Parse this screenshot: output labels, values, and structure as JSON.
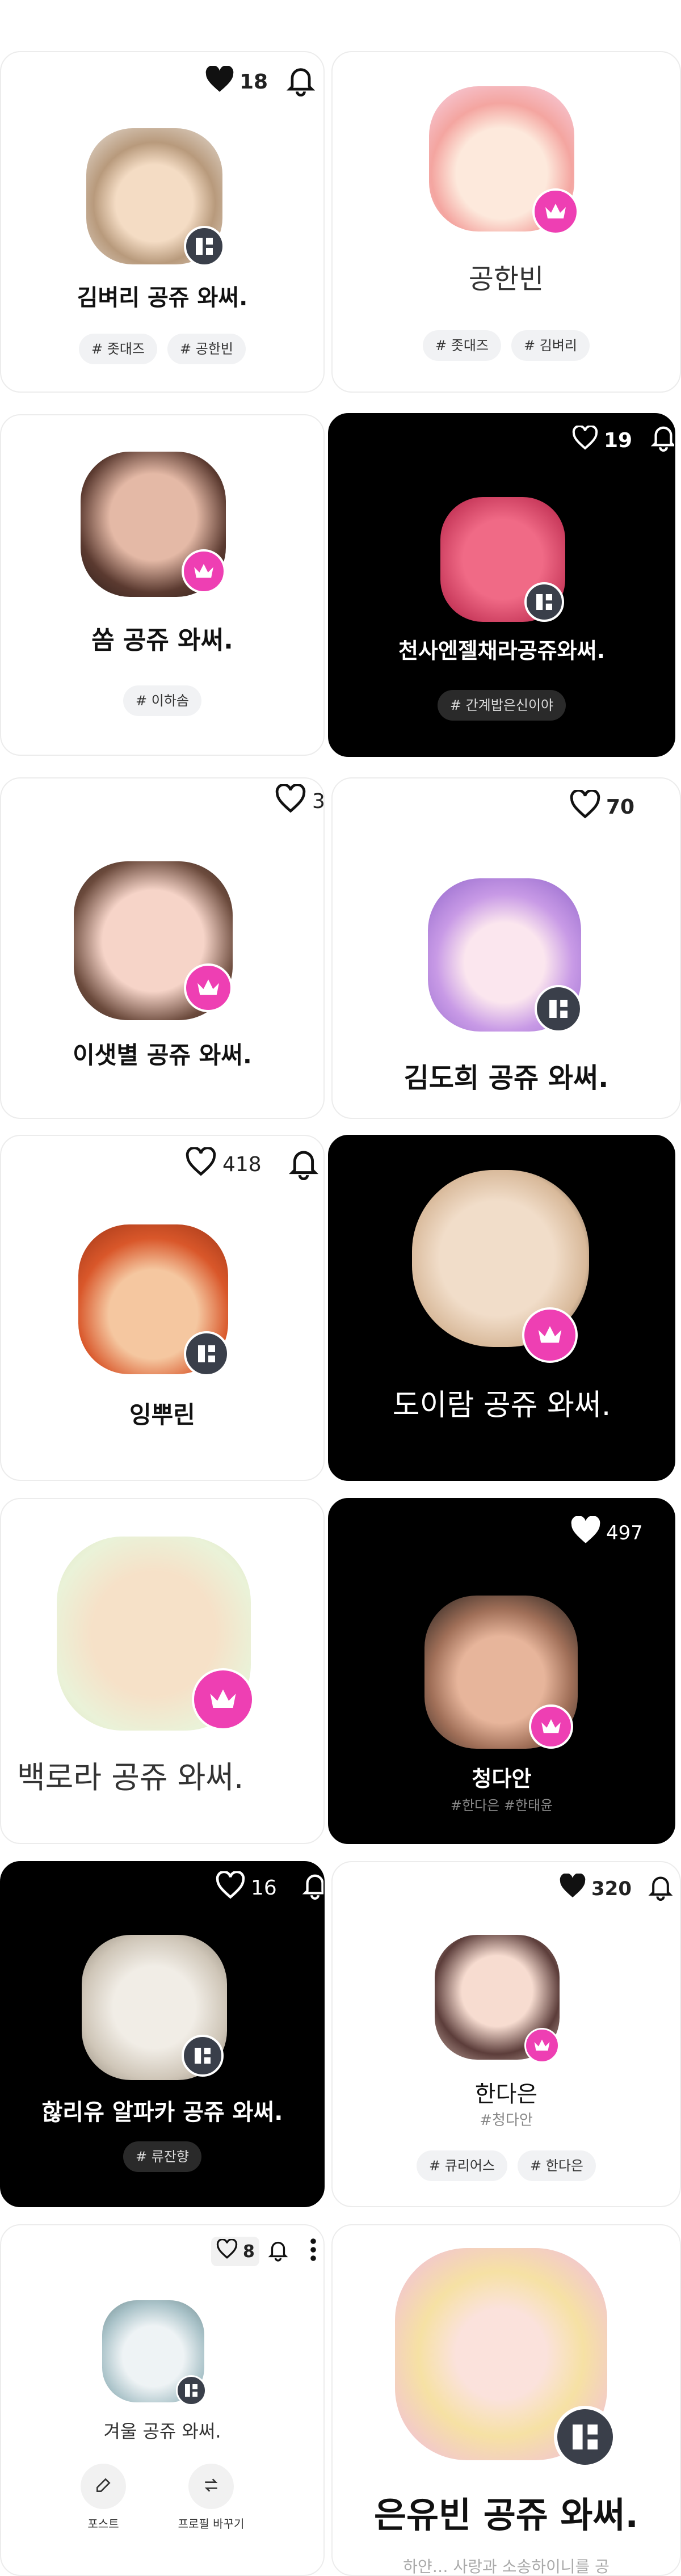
{
  "cards": [
    {
      "name": "김벼리 공쥬 와써.",
      "likes": "18",
      "tags": [
        "# 좃대즈",
        "# 공한빈"
      ]
    },
    {
      "name": "공한빈",
      "tags": [
        "# 좃대즈",
        "# 김벼리"
      ]
    },
    {
      "name": "쏨 공쥬 와써.",
      "tags": [
        "# 이하솜"
      ]
    },
    {
      "name": "천사엔젤채라공쥬와써.",
      "likes": "19",
      "tags": [
        "# 간계밥은신이야"
      ]
    },
    {
      "name": "이샛별 공쥬 와써.",
      "likes": "3"
    },
    {
      "name": "김도희 공쥬 와써.",
      "likes": "70"
    },
    {
      "name": "잉뿌린",
      "likes": "418"
    },
    {
      "name": "도이람 공쥬 와써."
    },
    {
      "name": "백로라 공쥬 와써."
    },
    {
      "name": "청다안",
      "likes": "497",
      "sub": "#한다은 #한태윤"
    },
    {
      "name": "핞리유 알파카 공쥬 와써.",
      "likes": "16",
      "tags": [
        "# 류잔향"
      ]
    },
    {
      "name": "한다은",
      "likes": "320",
      "sub": "#청다안",
      "tags": [
        "# 큐리어스",
        "# 한다은"
      ]
    },
    {
      "name": "겨울 공쥬 와써.",
      "likes": "8",
      "actions": [
        "포스트",
        "프로필 바꾸기"
      ]
    },
    {
      "name": "은유빈 공쥬 와써.",
      "sub": "하얀… 사랑과 소송하이니를 공"
    }
  ],
  "colors": {
    "crown_badge": "#ee3fb3",
    "grid_badge": "#3a3f4a",
    "dark_card": "#000000"
  }
}
